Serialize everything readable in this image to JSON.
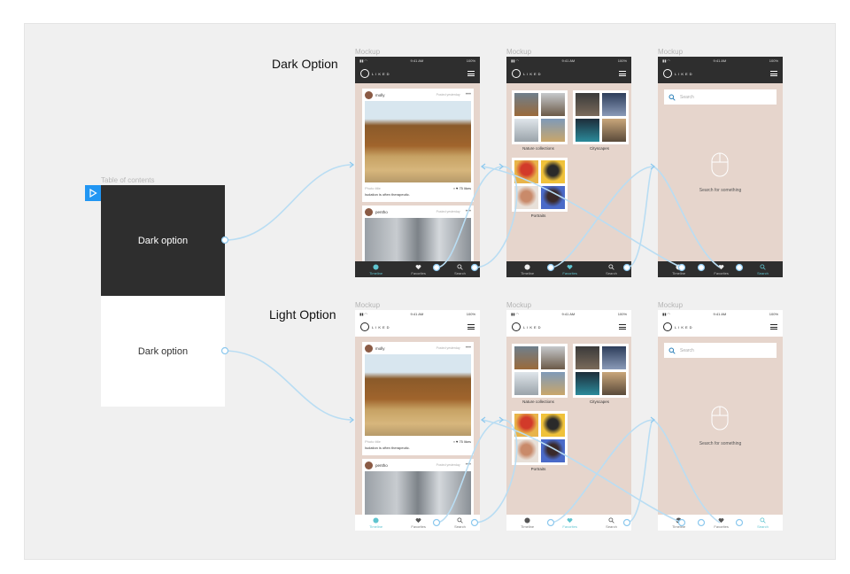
{
  "toc": {
    "label": "Table of contents",
    "items": [
      "Dark option",
      "Dark option"
    ]
  },
  "rows": [
    {
      "title": "Dark Option",
      "theme": "dark",
      "frames": [
        {
          "label": "Mockup",
          "status": {
            "time": "9:41 AM",
            "battery": "100%"
          },
          "logo": "LIKED",
          "posts": [
            {
              "user": "molly",
              "posted": "Posted yesterday",
              "title": "Photo title",
              "likes": "75 likes",
              "caption": "Isolation is often therapeutic."
            },
            {
              "user": "pentho",
              "posted": "Posted yesterday"
            }
          ],
          "tabs": [
            "Timeline",
            "Favorites",
            "Search"
          ]
        },
        {
          "label": "Mockup",
          "status": {
            "time": "9:41 AM",
            "battery": "100%"
          },
          "logo": "LIKED",
          "collections": [
            "Nature collections",
            "Cityscapes",
            "Portraits"
          ],
          "tabs": [
            "Timeline",
            "Favorites",
            "Search"
          ]
        },
        {
          "label": "Mockup",
          "status": {
            "time": "9:41 AM",
            "battery": "100%"
          },
          "logo": "LIKED",
          "search_placeholder": "Search",
          "empty_text": "Search for something",
          "tabs": [
            "Timeline",
            "Favorites",
            "Search"
          ]
        }
      ]
    },
    {
      "title": "Light Option",
      "theme": "light",
      "frames": [
        {
          "label": "Mockup",
          "status": {
            "time": "9:41 AM",
            "battery": "100%"
          },
          "logo": "LIKED",
          "posts": [
            {
              "user": "molly",
              "posted": "Posted yesterday",
              "title": "Photo title",
              "likes": "75 likes",
              "caption": "Isolation is often therapeutic."
            },
            {
              "user": "pentho",
              "posted": "Posted yesterday"
            }
          ],
          "tabs": [
            "Timeline",
            "Favorites",
            "Search"
          ]
        },
        {
          "label": "Mockup",
          "status": {
            "time": "9:41 AM",
            "battery": "100%"
          },
          "logo": "LIKED",
          "collections": [
            "Nature collections",
            "Cityscapes",
            "Portraits"
          ],
          "tabs": [
            "Timeline",
            "Favorites",
            "Search"
          ]
        },
        {
          "label": "Mockup",
          "status": {
            "time": "9:41 AM",
            "battery": "100%"
          },
          "logo": "LIKED",
          "search_placeholder": "Search",
          "empty_text": "Search for something",
          "tabs": [
            "Timeline",
            "Favorites",
            "Search"
          ]
        }
      ]
    }
  ],
  "colors": {
    "dark_bar": "#2e2e2e",
    "canvas_bg": "#e6d5cc",
    "accent": "#5fc4cf",
    "link": "#b9ddf3",
    "play_button": "#2196f3"
  },
  "icons": [
    "play-icon",
    "menu-icon",
    "timeline-icon",
    "heart-icon",
    "search-icon",
    "mouse-icon"
  ]
}
